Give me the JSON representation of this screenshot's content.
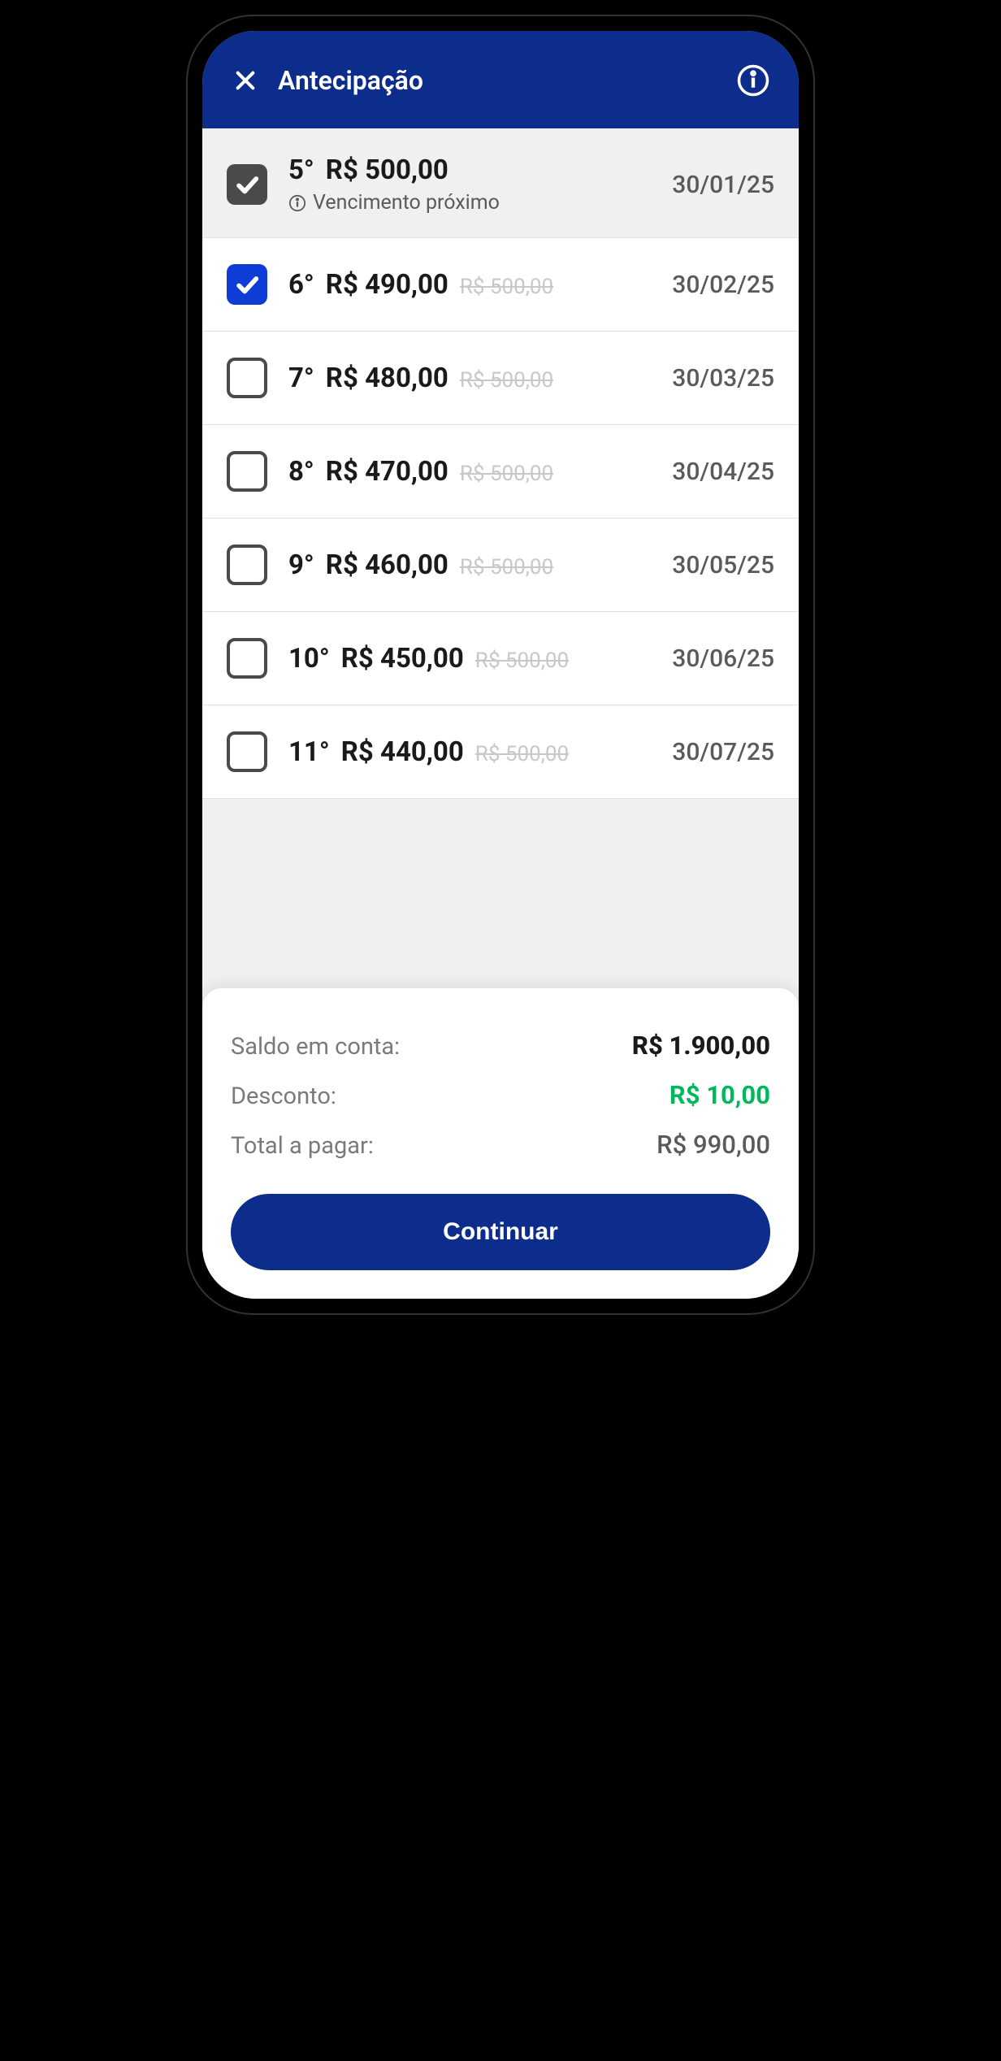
{
  "header": {
    "title": "Antecipação"
  },
  "items": [
    {
      "ordinal": "5°",
      "amount": "R$ 500,00",
      "original": "",
      "date": "30/01/25",
      "checked": true,
      "checkStyle": "gray",
      "warning": "Vencimento próximo"
    },
    {
      "ordinal": "6°",
      "amount": "R$ 490,00",
      "original": "R$ 500,00",
      "date": "30/02/25",
      "checked": true,
      "checkStyle": "blue",
      "warning": ""
    },
    {
      "ordinal": "7°",
      "amount": "R$ 480,00",
      "original": "R$ 500,00",
      "date": "30/03/25",
      "checked": false,
      "checkStyle": "",
      "warning": ""
    },
    {
      "ordinal": "8°",
      "amount": "R$ 470,00",
      "original": "R$ 500,00",
      "date": "30/04/25",
      "checked": false,
      "checkStyle": "",
      "warning": ""
    },
    {
      "ordinal": "9°",
      "amount": "R$ 460,00",
      "original": "R$ 500,00",
      "date": "30/05/25",
      "checked": false,
      "checkStyle": "",
      "warning": ""
    },
    {
      "ordinal": "10°",
      "amount": "R$ 450,00",
      "original": "R$ 500,00",
      "date": "30/06/25",
      "checked": false,
      "checkStyle": "",
      "warning": ""
    },
    {
      "ordinal": "11°",
      "amount": "R$ 440,00",
      "original": "R$ 500,00",
      "date": "30/07/25",
      "checked": false,
      "checkStyle": "",
      "warning": ""
    }
  ],
  "summary": {
    "balance_label": "Saldo em conta:",
    "balance_value": "R$ 1.900,00",
    "discount_label": "Desconto:",
    "discount_value": "R$ 10,00",
    "total_label": "Total a pagar:",
    "total_value": "R$ 990,00"
  },
  "cta": {
    "label": "Continuar"
  }
}
